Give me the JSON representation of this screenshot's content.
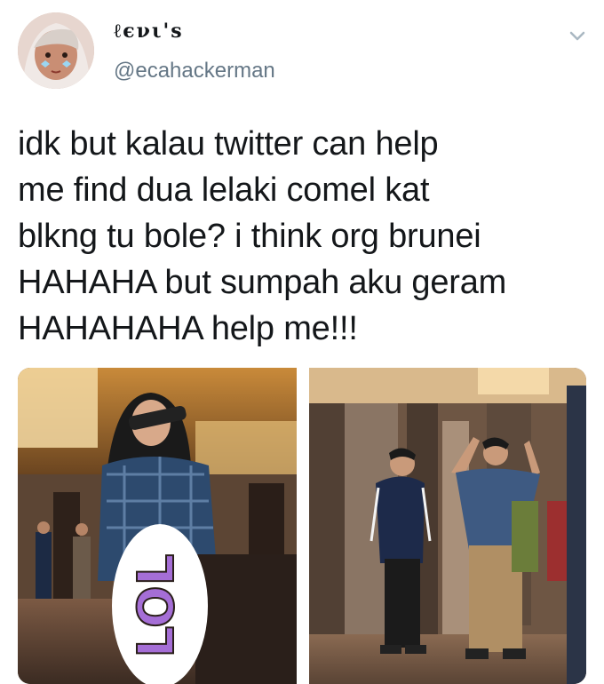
{
  "tweet": {
    "display_name": "ℓєνι'ѕ",
    "handle": "@ecahackerman",
    "text_lines": [
      "idk but kalau twitter can help",
      "me find dua lelaki comel kat",
      "blkng tu bole? i think org brunei",
      "HAHAHA but sumpah aku geram",
      "HAHAHAHA help me!!!"
    ]
  },
  "media": {
    "photo1_sticker": "LOL",
    "photo2_shirt_text": ""
  },
  "colors": {
    "text": "#14171a",
    "secondary": "#657786",
    "sticker_purple": "#a56ed6",
    "sticker_green": "#5fb89a"
  },
  "icons": {
    "menu": "chevron-down-icon"
  }
}
